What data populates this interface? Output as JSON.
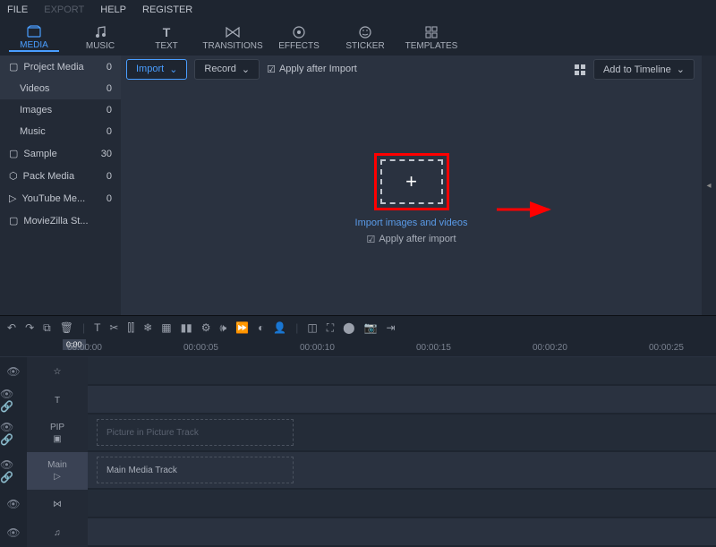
{
  "menu": {
    "file": "FILE",
    "export": "EXPORT",
    "help": "HELP",
    "register": "REGISTER"
  },
  "tabs": [
    {
      "label": "MEDIA"
    },
    {
      "label": "MUSIC"
    },
    {
      "label": "TEXT"
    },
    {
      "label": "TRANSITIONS"
    },
    {
      "label": "EFFECTS"
    },
    {
      "label": "STICKER"
    },
    {
      "label": "TEMPLATES"
    }
  ],
  "sidebar": [
    {
      "label": "Project Media",
      "count": "0",
      "icon": "folder"
    },
    {
      "label": "Videos",
      "count": "0",
      "sub": true
    },
    {
      "label": "Images",
      "count": "0",
      "sub": true
    },
    {
      "label": "Music",
      "count": "0",
      "sub": true
    },
    {
      "label": "Sample",
      "count": "30",
      "icon": "folder"
    },
    {
      "label": "Pack Media",
      "count": "0",
      "icon": "package"
    },
    {
      "label": "YouTube Me...",
      "count": "0",
      "icon": "youtube"
    },
    {
      "label": "MovieZilla St...",
      "count": "",
      "icon": "folder"
    }
  ],
  "toolbar": {
    "import": "Import",
    "record": "Record",
    "apply": "Apply after Import"
  },
  "right": {
    "add": "Add to Timeline"
  },
  "importzone": {
    "text": "Import images and videos",
    "apply": "Apply after import"
  },
  "ruler": [
    "00:00:00",
    "00:00:05",
    "00:00:10",
    "00:00:15",
    "00:00:20",
    "00:00:25"
  ],
  "marker": "0:00",
  "tracks": {
    "pip_label": "PIP",
    "pip_text": "Picture in Picture Track",
    "main_label": "Main",
    "main_text": "Main Media Track"
  }
}
